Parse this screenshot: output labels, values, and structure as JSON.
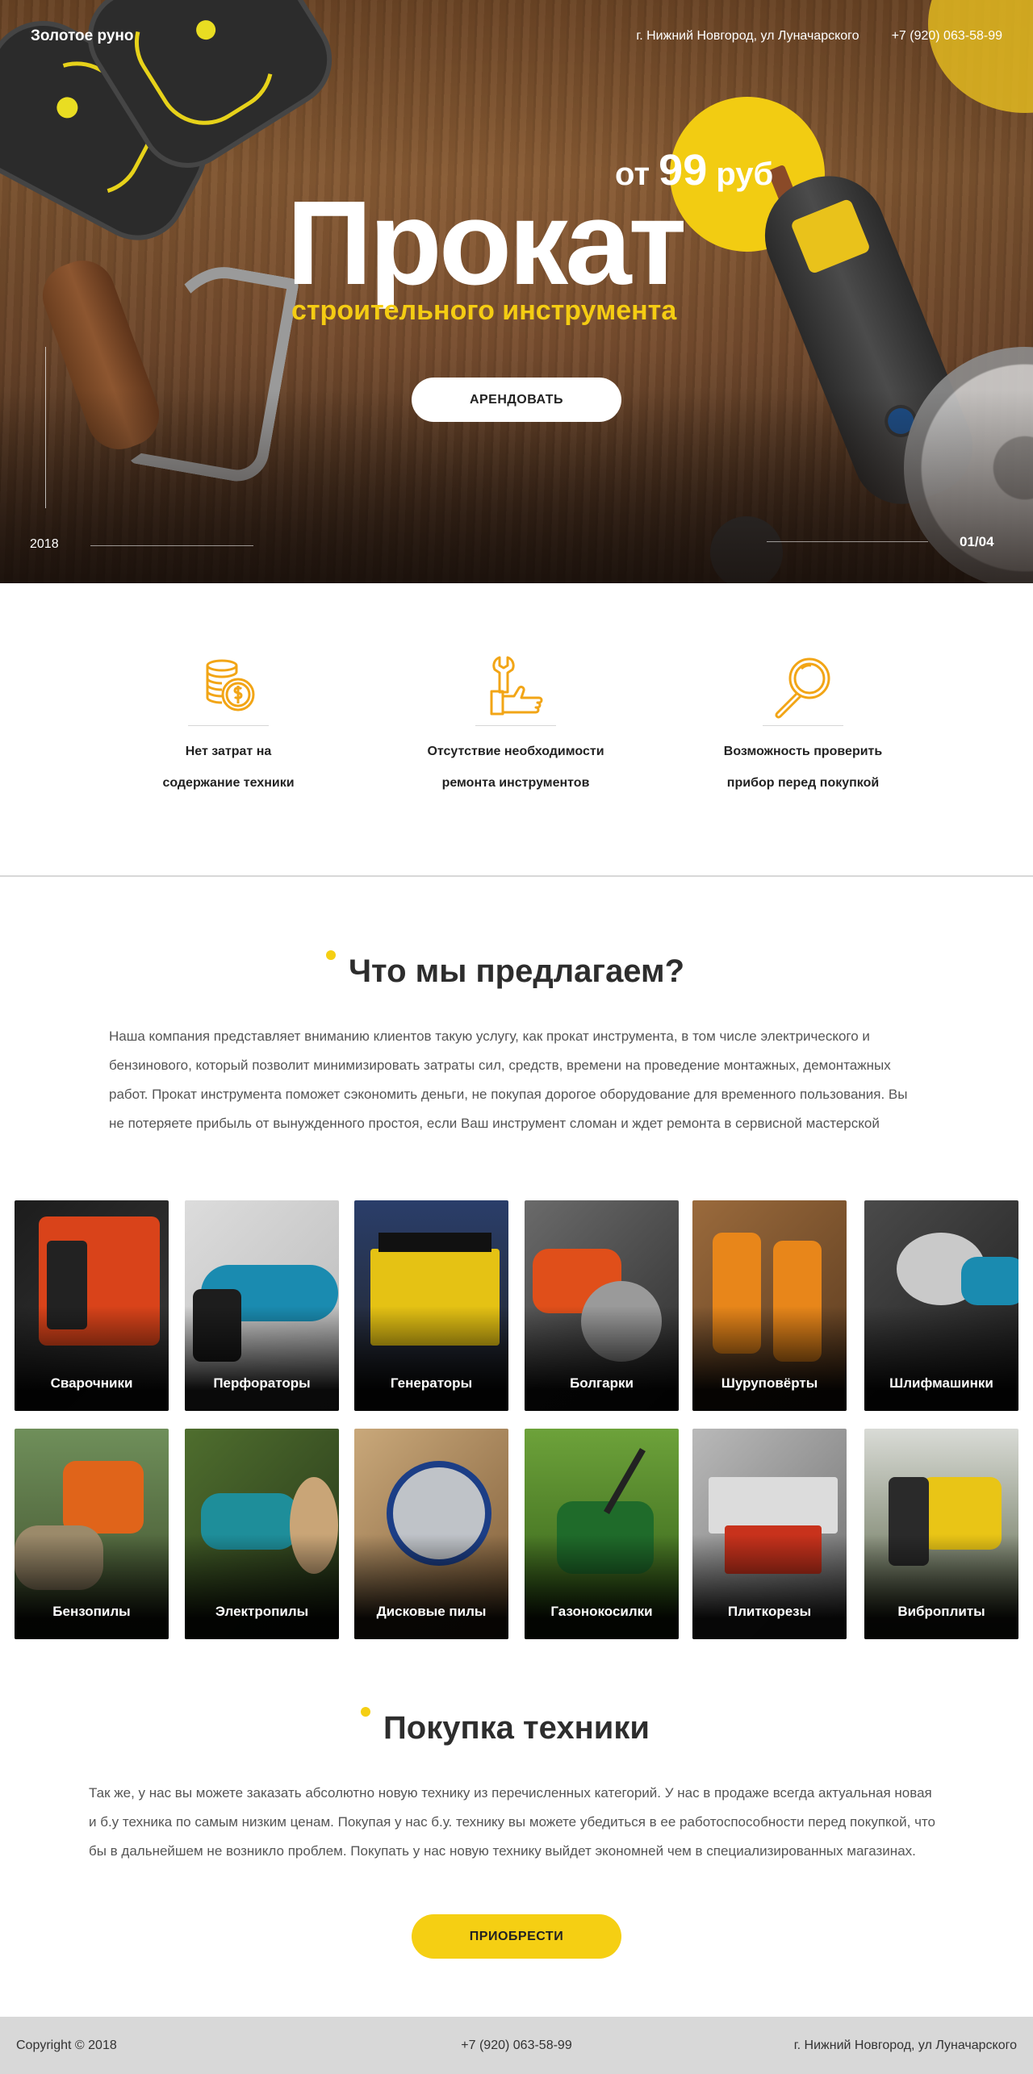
{
  "header": {
    "logo": "Золотое руно",
    "address": "г. Нижний Новгород, ул Луначарского",
    "phone": "+7 (920) 063-58-99"
  },
  "hero": {
    "price_prefix": "от",
    "price_value": "99",
    "price_suffix": "руб",
    "title": "Прокат",
    "subtitle": "строительного инструмента",
    "button": "АРЕНДОВАТЬ",
    "year": "2018",
    "counter": "01/04"
  },
  "benefits": [
    {
      "icon": "coins-icon",
      "line1": "Нет затрат на",
      "line2": "содержание техники"
    },
    {
      "icon": "wrench-hand-icon",
      "line1": "Отсутствие необходимости",
      "line2": "ремонта инструментов"
    },
    {
      "icon": "magnifier-icon",
      "line1": "Возможность проверить",
      "line2": "прибор перед покупкой"
    }
  ],
  "offer": {
    "title": "Что мы предлагаем?",
    "text_lines": [
      "Наша компания представляет вниманию клиентов такую услугу, как прокат инструмента, в том числе электрического и",
      "бензинового, который позволит минимизировать затраты сил, средств, времени на проведение монтажных, демонтажных",
      "работ. Прокат инструмента поможет сэкономить деньги, не покупая дорогое оборудование для временного пользования. Вы",
      "не потеряете прибыль от вынужденного простоя, если Ваш инструмент сломан и ждет ремонта в сервисной мастерской"
    ]
  },
  "categories": [
    "Сварочники",
    "Перфораторы",
    "Генераторы",
    "Болгарки",
    "Шуруповёрты",
    "Шлифмашинки",
    "Бензопилы",
    "Электропилы",
    "Дисковые пилы",
    "Газонокосилки",
    "Плиткорезы",
    "Виброплиты"
  ],
  "buy": {
    "title": "Покупка техники",
    "text_lines": [
      "Так же, у нас вы можете заказать абсолютно новую технику из перечисленных категорий. У нас в продаже всегда актуальная новая",
      "и б.у техника по самым низким ценам. Покупая у нас б.у. технику вы можете убедиться в ее работоспособности перед покупкой, что",
      "бы в дальнейшем не возникло проблем. Покупать у нас новую технику выйдет экономней чем в специализированных магазинах."
    ],
    "button": "ПРИОБРЕСТИ"
  },
  "footer": {
    "copyright": "Copyright © 2018",
    "phone": "+7 (920) 063-58-99",
    "address": "г. Нижний Новгород, ул Луначарского"
  },
  "colors": {
    "accent": "#f5cf13",
    "icon": "#f2a516",
    "footer_bg": "#d8d8d8"
  }
}
